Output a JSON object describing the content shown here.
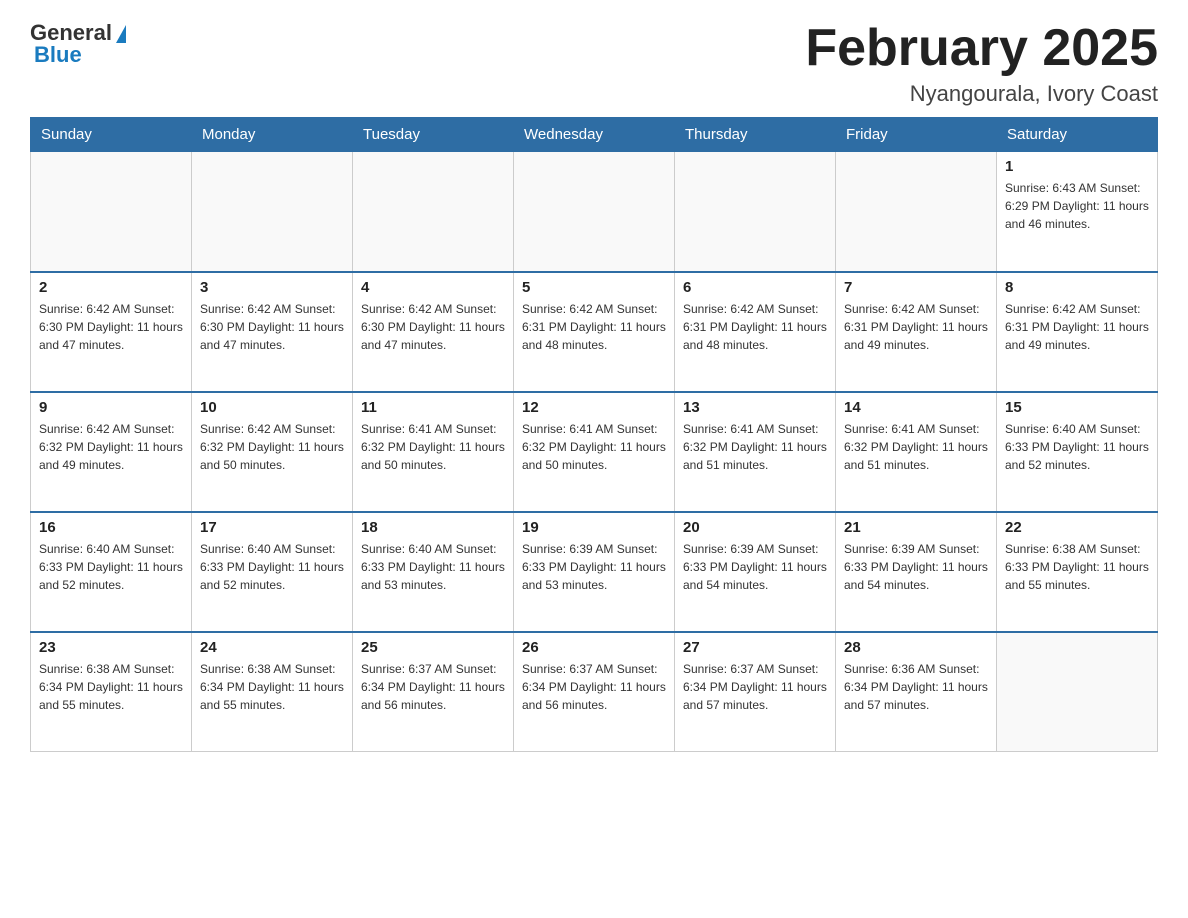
{
  "logo": {
    "general": "General",
    "blue": "Blue"
  },
  "header": {
    "month": "February 2025",
    "location": "Nyangourala, Ivory Coast"
  },
  "days_of_week": [
    "Sunday",
    "Monday",
    "Tuesday",
    "Wednesday",
    "Thursday",
    "Friday",
    "Saturday"
  ],
  "weeks": [
    [
      {
        "day": "",
        "info": ""
      },
      {
        "day": "",
        "info": ""
      },
      {
        "day": "",
        "info": ""
      },
      {
        "day": "",
        "info": ""
      },
      {
        "day": "",
        "info": ""
      },
      {
        "day": "",
        "info": ""
      },
      {
        "day": "1",
        "info": "Sunrise: 6:43 AM\nSunset: 6:29 PM\nDaylight: 11 hours and 46 minutes."
      }
    ],
    [
      {
        "day": "2",
        "info": "Sunrise: 6:42 AM\nSunset: 6:30 PM\nDaylight: 11 hours and 47 minutes."
      },
      {
        "day": "3",
        "info": "Sunrise: 6:42 AM\nSunset: 6:30 PM\nDaylight: 11 hours and 47 minutes."
      },
      {
        "day": "4",
        "info": "Sunrise: 6:42 AM\nSunset: 6:30 PM\nDaylight: 11 hours and 47 minutes."
      },
      {
        "day": "5",
        "info": "Sunrise: 6:42 AM\nSunset: 6:31 PM\nDaylight: 11 hours and 48 minutes."
      },
      {
        "day": "6",
        "info": "Sunrise: 6:42 AM\nSunset: 6:31 PM\nDaylight: 11 hours and 48 minutes."
      },
      {
        "day": "7",
        "info": "Sunrise: 6:42 AM\nSunset: 6:31 PM\nDaylight: 11 hours and 49 minutes."
      },
      {
        "day": "8",
        "info": "Sunrise: 6:42 AM\nSunset: 6:31 PM\nDaylight: 11 hours and 49 minutes."
      }
    ],
    [
      {
        "day": "9",
        "info": "Sunrise: 6:42 AM\nSunset: 6:32 PM\nDaylight: 11 hours and 49 minutes."
      },
      {
        "day": "10",
        "info": "Sunrise: 6:42 AM\nSunset: 6:32 PM\nDaylight: 11 hours and 50 minutes."
      },
      {
        "day": "11",
        "info": "Sunrise: 6:41 AM\nSunset: 6:32 PM\nDaylight: 11 hours and 50 minutes."
      },
      {
        "day": "12",
        "info": "Sunrise: 6:41 AM\nSunset: 6:32 PM\nDaylight: 11 hours and 50 minutes."
      },
      {
        "day": "13",
        "info": "Sunrise: 6:41 AM\nSunset: 6:32 PM\nDaylight: 11 hours and 51 minutes."
      },
      {
        "day": "14",
        "info": "Sunrise: 6:41 AM\nSunset: 6:32 PM\nDaylight: 11 hours and 51 minutes."
      },
      {
        "day": "15",
        "info": "Sunrise: 6:40 AM\nSunset: 6:33 PM\nDaylight: 11 hours and 52 minutes."
      }
    ],
    [
      {
        "day": "16",
        "info": "Sunrise: 6:40 AM\nSunset: 6:33 PM\nDaylight: 11 hours and 52 minutes."
      },
      {
        "day": "17",
        "info": "Sunrise: 6:40 AM\nSunset: 6:33 PM\nDaylight: 11 hours and 52 minutes."
      },
      {
        "day": "18",
        "info": "Sunrise: 6:40 AM\nSunset: 6:33 PM\nDaylight: 11 hours and 53 minutes."
      },
      {
        "day": "19",
        "info": "Sunrise: 6:39 AM\nSunset: 6:33 PM\nDaylight: 11 hours and 53 minutes."
      },
      {
        "day": "20",
        "info": "Sunrise: 6:39 AM\nSunset: 6:33 PM\nDaylight: 11 hours and 54 minutes."
      },
      {
        "day": "21",
        "info": "Sunrise: 6:39 AM\nSunset: 6:33 PM\nDaylight: 11 hours and 54 minutes."
      },
      {
        "day": "22",
        "info": "Sunrise: 6:38 AM\nSunset: 6:33 PM\nDaylight: 11 hours and 55 minutes."
      }
    ],
    [
      {
        "day": "23",
        "info": "Sunrise: 6:38 AM\nSunset: 6:34 PM\nDaylight: 11 hours and 55 minutes."
      },
      {
        "day": "24",
        "info": "Sunrise: 6:38 AM\nSunset: 6:34 PM\nDaylight: 11 hours and 55 minutes."
      },
      {
        "day": "25",
        "info": "Sunrise: 6:37 AM\nSunset: 6:34 PM\nDaylight: 11 hours and 56 minutes."
      },
      {
        "day": "26",
        "info": "Sunrise: 6:37 AM\nSunset: 6:34 PM\nDaylight: 11 hours and 56 minutes."
      },
      {
        "day": "27",
        "info": "Sunrise: 6:37 AM\nSunset: 6:34 PM\nDaylight: 11 hours and 57 minutes."
      },
      {
        "day": "28",
        "info": "Sunrise: 6:36 AM\nSunset: 6:34 PM\nDaylight: 11 hours and 57 minutes."
      },
      {
        "day": "",
        "info": ""
      }
    ]
  ]
}
